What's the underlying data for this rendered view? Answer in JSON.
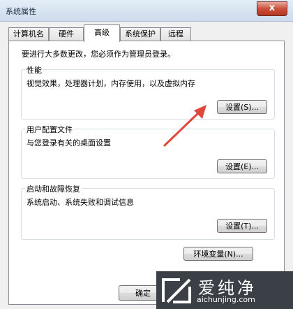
{
  "window": {
    "title": "系统属性",
    "close_symbol": "x"
  },
  "tabs": [
    {
      "label": "计算机名"
    },
    {
      "label": "硬件"
    },
    {
      "label": "高级",
      "active": true
    },
    {
      "label": "系统保护"
    },
    {
      "label": "远程"
    }
  ],
  "notice": "要进行大多数更改，您必须作为管理员登录。",
  "performance": {
    "title": "性能",
    "description": "视觉效果，处理器计划，内存使用，以及虚拟内存",
    "button": "设置(S)..."
  },
  "user_profiles": {
    "title": "用户配置文件",
    "description": "与您登录有关的桌面设置",
    "button": "设置(E)..."
  },
  "startup_recovery": {
    "title": "启动和故障恢复",
    "description": "系统启动、系统失败和调试信息",
    "button": "设置(T)..."
  },
  "env_button": "环境变量(N)...",
  "ok_button": "确定",
  "watermark": {
    "brand": "爱纯净",
    "url": "aichunjing.com"
  },
  "colors": {
    "arrow": "#e0473a",
    "watermark_bg": "#3a4046"
  }
}
